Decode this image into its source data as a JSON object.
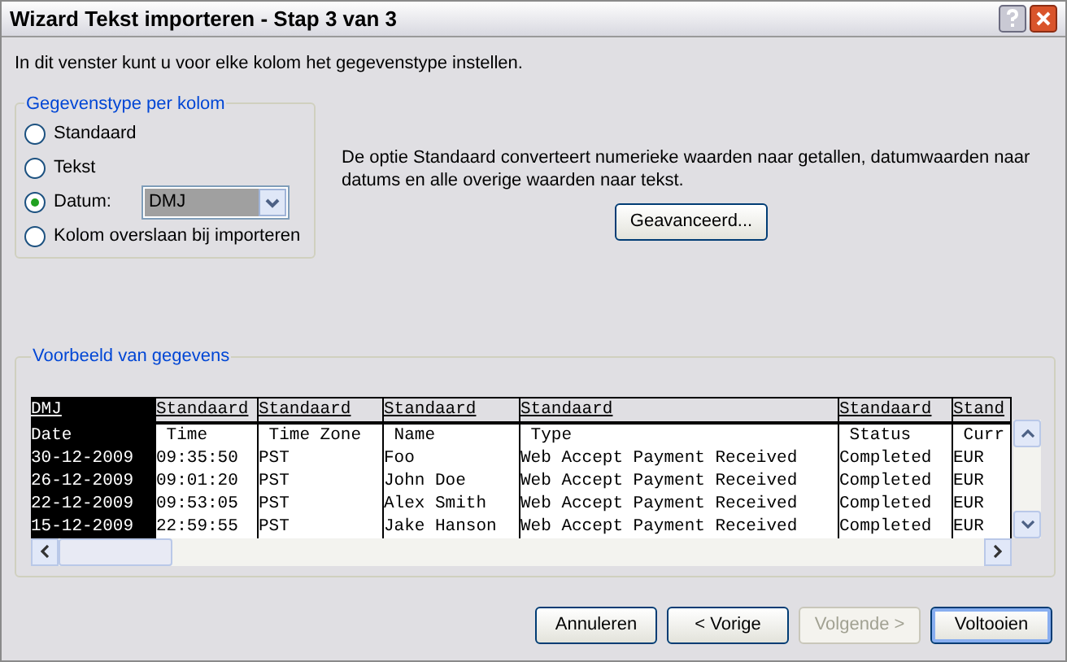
{
  "window": {
    "title": "Wizard Tekst importeren - Stap 3 van 3"
  },
  "intro": "In dit venster kunt u voor elke kolom het gegevenstype instellen.",
  "column_type": {
    "legend": "Gegevenstype per kolom",
    "options": [
      {
        "label": "Standaard",
        "selected": false
      },
      {
        "label": "Tekst",
        "selected": false
      },
      {
        "label": "Datum:",
        "selected": true,
        "kind": "date"
      },
      {
        "label": "Kolom overslaan bij importeren",
        "selected": false
      }
    ],
    "date_format": "DMJ"
  },
  "description": "De optie Standaard converteert numerieke waarden naar getallen, datumwaarden naar datums en alle overige waarden naar tekst.",
  "advanced_button": "Geavanceerd...",
  "preview": {
    "legend": "Voorbeeld van gegevens",
    "columns": [
      {
        "type": "DMJ",
        "selected": true
      },
      {
        "type": "Standaard",
        "selected": false
      },
      {
        "type": "Standaard",
        "selected": false
      },
      {
        "type": "Standaard",
        "selected": false
      },
      {
        "type": "Standaard",
        "selected": false
      },
      {
        "type": "Standaard",
        "selected": false
      },
      {
        "type": "Stand",
        "selected": false
      }
    ],
    "rows": [
      [
        "Date",
        " Time",
        " Time Zone",
        " Name",
        " Type",
        " Status",
        " Curr"
      ],
      [
        "30-12-2009",
        "09:35:50",
        "PST",
        "Foo",
        "Web Accept Payment Received",
        "Completed",
        "EUR"
      ],
      [
        "26-12-2009",
        "09:01:20",
        "PST",
        "John Doe",
        "Web Accept Payment Received",
        "Completed",
        "EUR"
      ],
      [
        "22-12-2009",
        "09:53:05",
        "PST",
        "Alex Smith",
        "Web Accept Payment Received",
        "Completed",
        "EUR"
      ],
      [
        "15-12-2009",
        "22:59:55",
        "PST",
        "Jake Hanson",
        "Web Accept Payment Received",
        "Completed",
        "EUR"
      ]
    ]
  },
  "buttons": [
    {
      "label": "Annuleren",
      "disabled": false,
      "default": false
    },
    {
      "label": "< Vorige",
      "disabled": false,
      "default": false
    },
    {
      "label": "Volgende >",
      "disabled": true,
      "default": false
    },
    {
      "label": "Voltooien",
      "disabled": false,
      "default": true
    }
  ]
}
